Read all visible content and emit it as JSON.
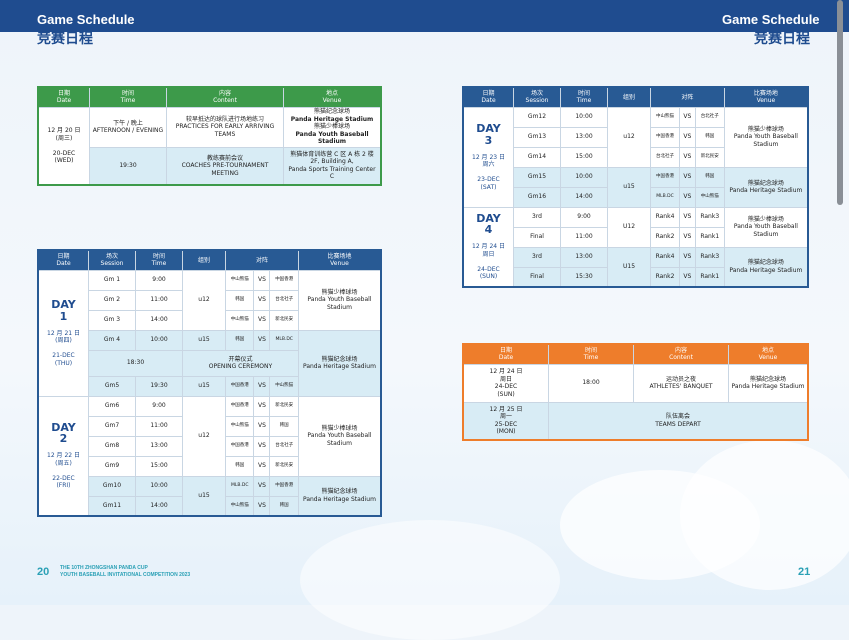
{
  "header": {
    "en": "Game Schedule",
    "cn": "竞赛日程"
  },
  "footer": {
    "left_page": "20",
    "right_page": "21",
    "line1": "THE 10TH ZHONGSHAN PANDA CUP",
    "line2": "YOUTH BASEBALL INVITATIONAL COMPETITION 2023"
  },
  "t1": {
    "headers": [
      [
        "日期",
        "Date"
      ],
      [
        "时间",
        "Time"
      ],
      [
        "内容",
        "Content"
      ],
      [
        "地点",
        "Venue"
      ]
    ],
    "day": {
      "cn": "12 月 20 日",
      "wk": "(周三)",
      "en": "20-DEC",
      "wk_en": "(WED)"
    },
    "rows": [
      {
        "time": "下午 / 晚上",
        "time2": "AFTERNOON / EVENING",
        "content": "较早抵达的球队进行场地练习",
        "content2": "PRACTICES FOR EARLY ARRIVING TEAMS",
        "venue": "熊猫纪念球场",
        "venue2": "Panda Heritage Stadium",
        "venue3": "熊猫少棒球场",
        "venue4": "Panda Youth Baseball Stadium"
      },
      {
        "time": "19:30",
        "content": "教练赛前会议",
        "content2": "COACHES PRE-TOURNAMENT MEETING",
        "venue": "熊猫体育训练营 C 区 A 栋 2 楼",
        "venue2": "2F, Building A,",
        "venue3": "Panda Sports Training Center C"
      }
    ]
  },
  "t2": {
    "headers": [
      [
        "日期",
        "Date"
      ],
      [
        "场次",
        "Session"
      ],
      [
        "时间",
        "Time"
      ],
      [
        "组别",
        ""
      ],
      [
        "对阵",
        ""
      ],
      [
        "比赛场地",
        "Venue"
      ]
    ],
    "day1": {
      "cn": "12 月 21 日",
      "wk": "(周四)",
      "en": "21-DEC",
      "wk_en": "(THU)",
      "big1": "DAY",
      "big2": "1"
    },
    "day2": {
      "cn": "12 月 22 日",
      "wk": "(周五)",
      "en": "22-DEC",
      "wk_en": "(FRI)",
      "big1": "DAY",
      "big2": "2"
    },
    "rows": [
      {
        "s": "Gm 1",
        "t": "9:00",
        "a": "中山熊猫",
        "v": "VS",
        "b": "中国香港"
      },
      {
        "s": "Gm 2",
        "t": "11:00",
        "a": "韩国",
        "v": "VS",
        "b": "台北社子"
      },
      {
        "s": "Gm 3",
        "t": "14:00",
        "a": "中山熊猫",
        "v": "VS",
        "b": "新北民安"
      },
      {
        "s": "Gm 4",
        "t": "10:00",
        "a": "韩国",
        "v": "VS",
        "b": "MLB.DC"
      },
      {
        "s": "Gm5",
        "t": "19:30",
        "a": "中国香港",
        "v": "VS",
        "b": "中山熊猫"
      },
      {
        "s": "Gm6",
        "t": "9:00",
        "a": "中国香港",
        "v": "VS",
        "b": "新北民安"
      },
      {
        "s": "Gm7",
        "t": "11:00",
        "a": "中山熊猫",
        "v": "VS",
        "b": "韩国"
      },
      {
        "s": "Gm8",
        "t": "13:00",
        "a": "中国香港",
        "v": "VS",
        "b": "台北社子"
      },
      {
        "s": "Gm9",
        "t": "15:00",
        "a": "韩国",
        "v": "VS",
        "b": "新北民安"
      },
      {
        "s": "Gm10",
        "t": "10:00",
        "a": "MLB.DC",
        "v": "VS",
        "b": "中国香港"
      },
      {
        "s": "Gm11",
        "t": "14:00",
        "a": "中山熊猫",
        "v": "VS",
        "b": "韩国"
      }
    ],
    "ceremony": {
      "t": "18:30",
      "cn": "开幕仪式",
      "en": "OPENING CEREMONY"
    },
    "u12": "u12",
    "u15": "u15",
    "venue_y": [
      "熊猫少棒球场",
      "Panda Youth Baseball Stadium"
    ],
    "venue_h": [
      "熊猫纪念球场",
      "Panda Heritage Stadium"
    ]
  },
  "t3": {
    "headers": [
      [
        "场次",
        "Session"
      ],
      [
        "时间",
        "Time"
      ],
      [
        "组别",
        ""
      ],
      [
        "对阵",
        ""
      ],
      [
        "比赛场地",
        "Venue"
      ]
    ],
    "date_header": [
      "日期",
      "Date"
    ],
    "day3": {
      "big1": "DAY",
      "big2": "3",
      "cn": "12 月 23 日",
      "wk": "周六",
      "en": "23-DEC",
      "wk_en": "(SAT)"
    },
    "day4": {
      "big1": "DAY",
      "big2": "4",
      "cn": "12 月 24 日",
      "wk": "周日",
      "en": "24-DEC",
      "wk_en": "(SUN)"
    },
    "rows": [
      {
        "s": "Gm12",
        "t": "10:00",
        "a": "中山熊猫",
        "v": "VS",
        "b": "台北社子"
      },
      {
        "s": "Gm13",
        "t": "13:00",
        "a": "中国香港",
        "v": "VS",
        "b": "韩国"
      },
      {
        "s": "Gm14",
        "t": "15:00",
        "a": "台北社子",
        "v": "VS",
        "b": "新北民安"
      },
      {
        "s": "Gm15",
        "t": "10:00",
        "a": "中国香港",
        "v": "VS",
        "b": "韩国"
      },
      {
        "s": "Gm16",
        "t": "14:00",
        "a": "MLB.DC",
        "v": "VS",
        "b": "中山熊猫"
      },
      {
        "s": "3rd",
        "t": "9:00",
        "a": "Rank4",
        "v": "VS",
        "b": "Rank3"
      },
      {
        "s": "Final",
        "t": "11:00",
        "a": "Rank2",
        "v": "VS",
        "b": "Rank1"
      },
      {
        "s": "3rd",
        "t": "13:00",
        "a": "Rank4",
        "v": "VS",
        "b": "Rank3"
      },
      {
        "s": "Final",
        "t": "15:30",
        "a": "Rank2",
        "v": "VS",
        "b": "Rank1"
      }
    ],
    "g1": "u12",
    "g2": "u15",
    "g3": "U12",
    "g4": "U15"
  },
  "t4": {
    "headers": [
      [
        "日期",
        "Date"
      ],
      [
        "时间",
        "Time"
      ],
      [
        "内容",
        "Content"
      ],
      [
        "地点",
        "Venue"
      ]
    ],
    "r1": {
      "cn": "12 月 24 日",
      "wk": "周日",
      "en": "24-DEC",
      "wk_en": "(SUN)",
      "t": "18:00",
      "c": "运动员之夜",
      "c2": "ATHLETES' BANQUET",
      "v": "熊猫纪念球场",
      "v2": "Panda Heritage Stadium"
    },
    "r2": {
      "cn": "12 月 25 日",
      "wk": "周一",
      "en": "25-DEC",
      "wk_en": "(MON)",
      "c": "队伍离会",
      "c2": "TEAMS DEPART"
    }
  }
}
